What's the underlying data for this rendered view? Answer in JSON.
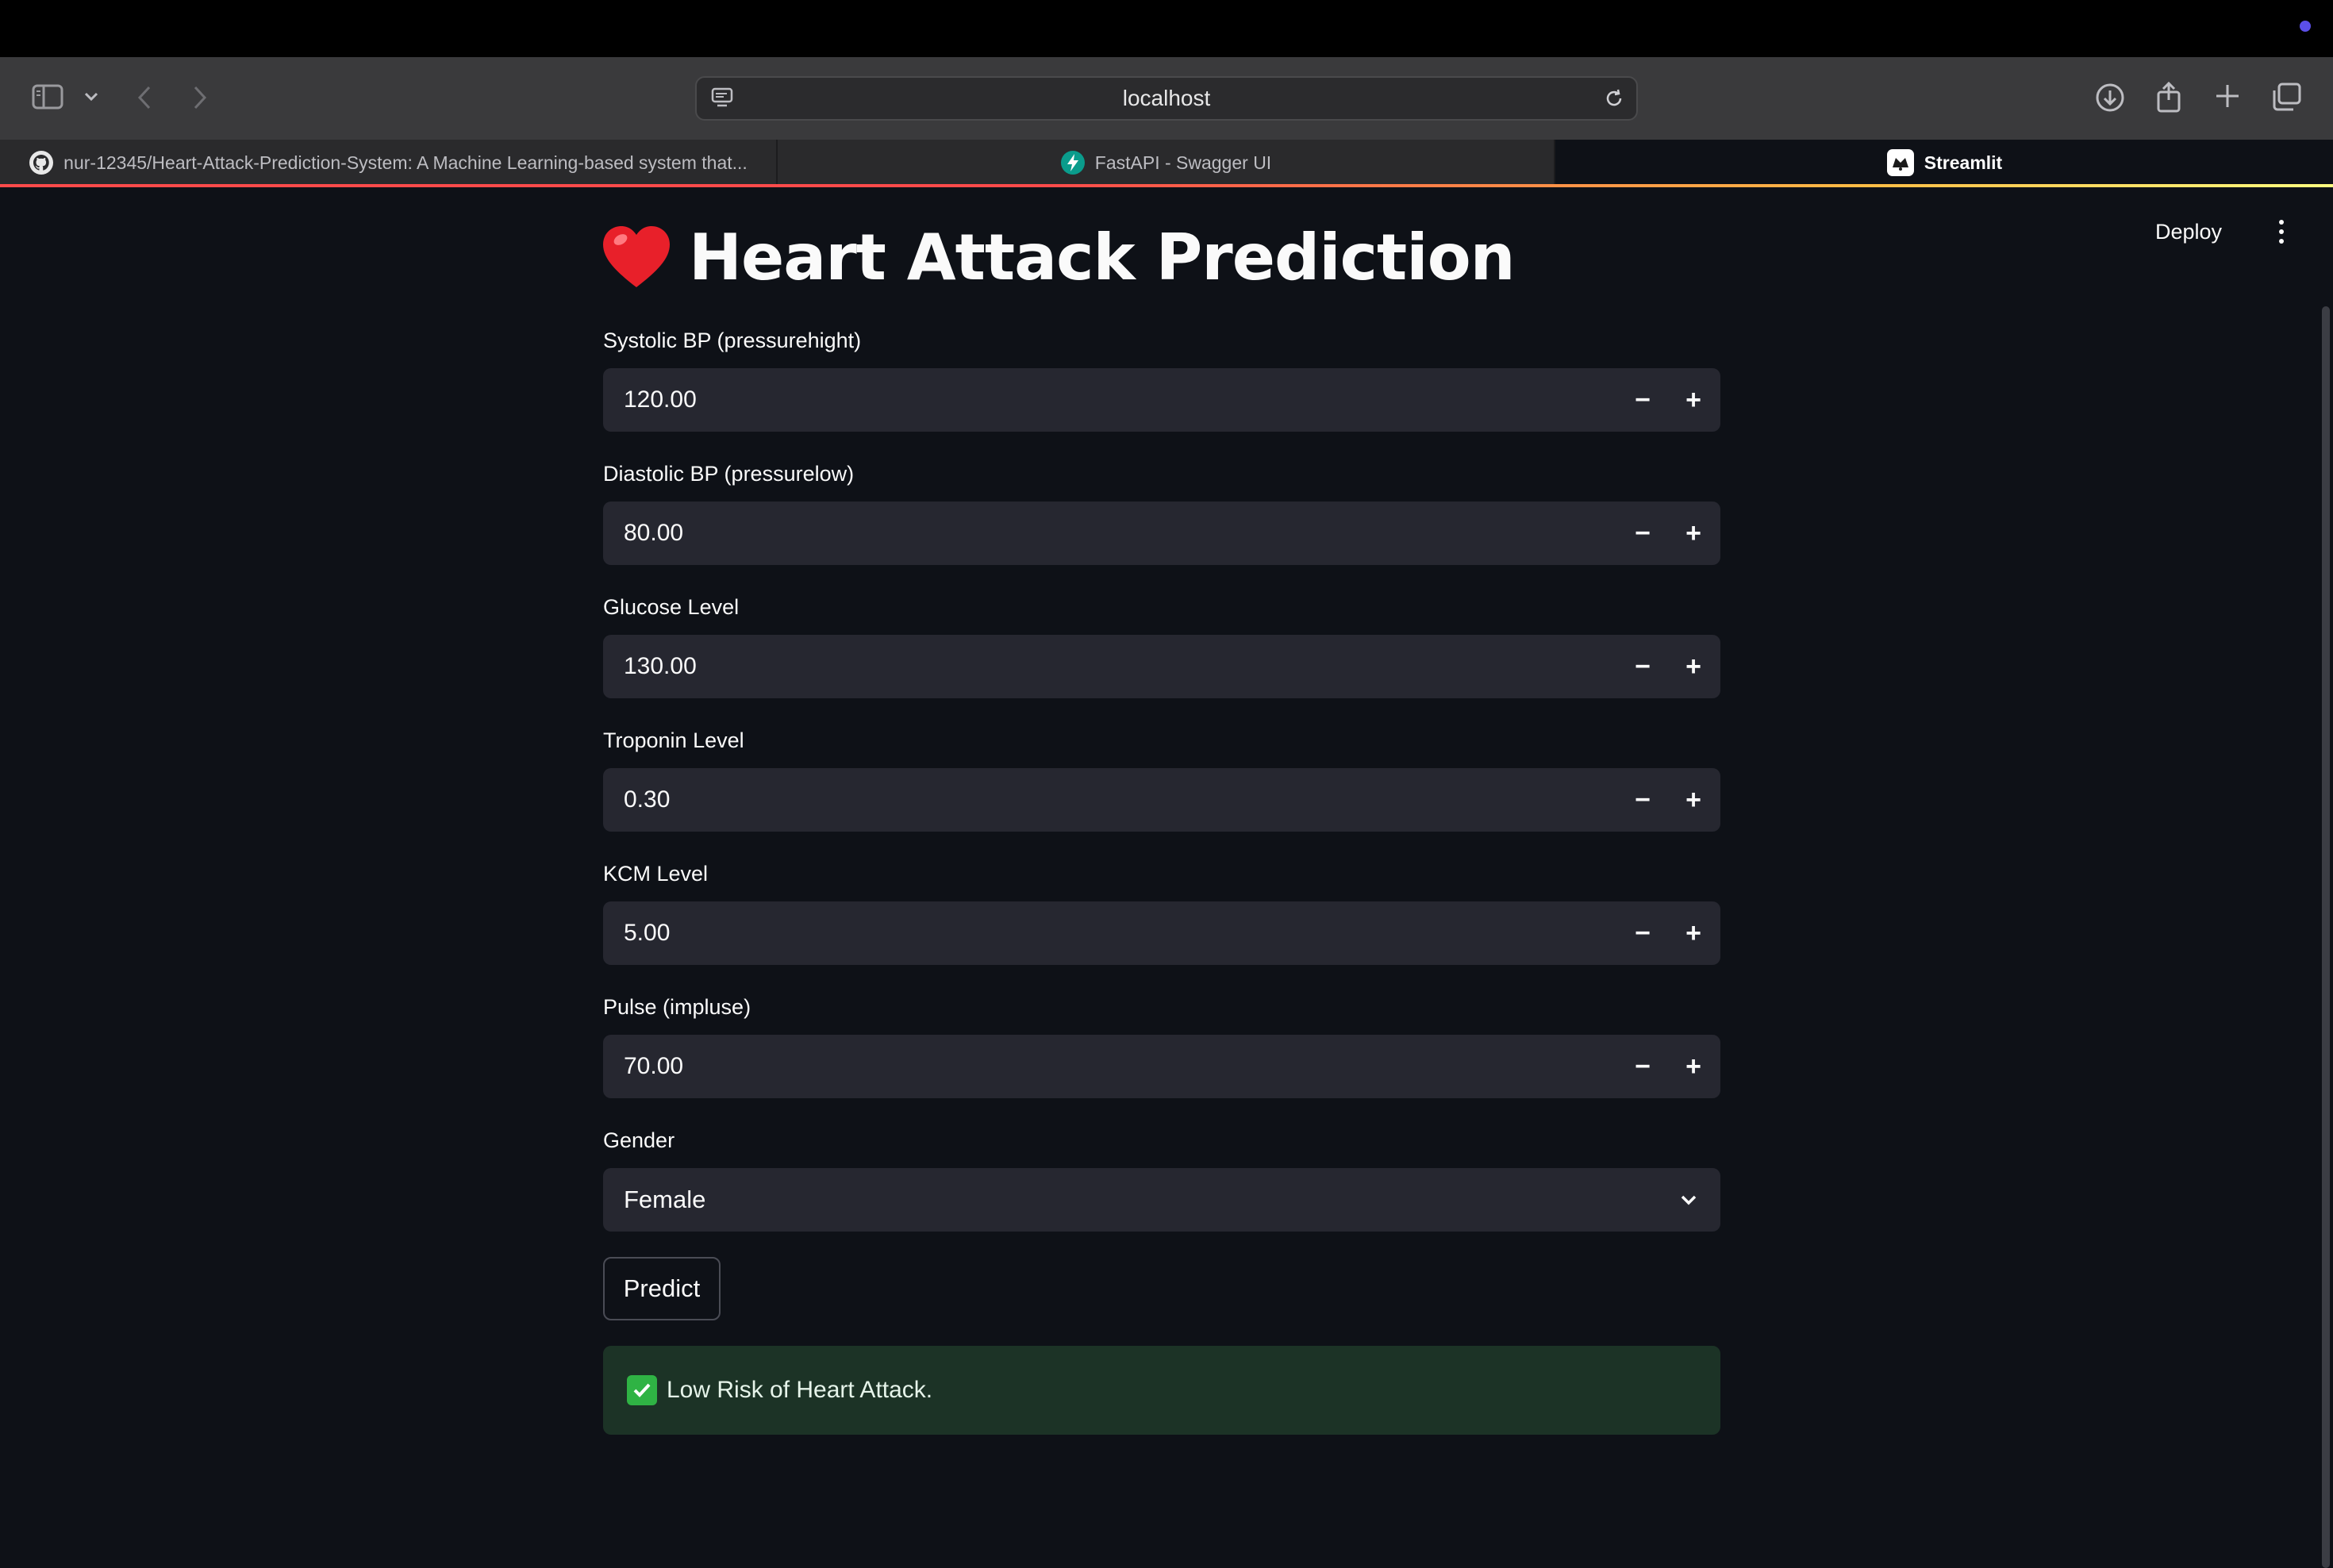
{
  "browser": {
    "url": "localhost",
    "tabs": [
      {
        "label": "nur-12345/Heart-Attack-Prediction-System: A Machine Learning-based system that...",
        "icon": "github-icon"
      },
      {
        "label": "FastAPI - Swagger UI",
        "icon": "fastapi-icon"
      },
      {
        "label": "Streamlit",
        "icon": "streamlit-icon"
      }
    ]
  },
  "header": {
    "deploy_label": "Deploy"
  },
  "page": {
    "title": "Heart Attack Prediction"
  },
  "fields": [
    {
      "label": "Systolic BP (pressurehight)",
      "value": "120.00"
    },
    {
      "label": "Diastolic BP (pressurelow)",
      "value": "80.00"
    },
    {
      "label": "Glucose Level",
      "value": "130.00"
    },
    {
      "label": "Troponin Level",
      "value": "0.30"
    },
    {
      "label": "KCM Level",
      "value": "5.00"
    },
    {
      "label": "Pulse (impluse)",
      "value": "70.00"
    }
  ],
  "gender": {
    "label": "Gender",
    "value": "Female"
  },
  "predict_label": "Predict",
  "result": {
    "text": "Low Risk of Heart Attack.",
    "color": "#1c3326"
  },
  "colors": {
    "background": "#0e1117",
    "input": "#262730",
    "accent": "#ff4b4b"
  }
}
